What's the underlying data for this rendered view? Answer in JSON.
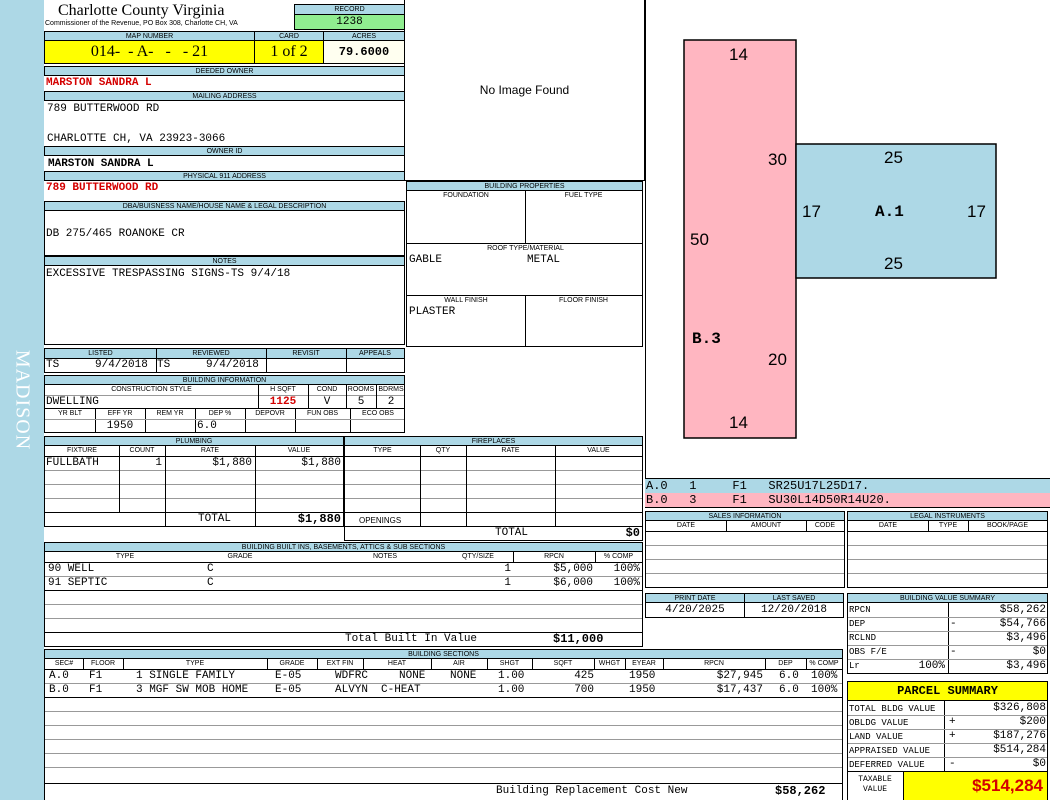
{
  "sidebar": {
    "label": "MADISON",
    "color": "#add8e6"
  },
  "header": {
    "county": "Charlotte County Virginia",
    "address": "Commissioner of the Revenue, PO Box 308, Charlotte CH, VA",
    "record_label": "RECORD",
    "record": "1238"
  },
  "parcel": {
    "map_label": "MAP NUMBER",
    "map": "014-  - A-   -   - 21",
    "card_label": "CARD",
    "card": "1 of 2",
    "acres_label": "ACRES",
    "acres": "79.6000"
  },
  "owner": {
    "deeded_label": "DEEDED OWNER",
    "deeded": "MARSTON SANDRA L",
    "mailing_label": "MAILING ADDRESS",
    "mail1": "789 BUTTERWOOD RD",
    "mail2": "CHARLOTTE CH, VA 23923-3066",
    "id_label": "OWNER ID",
    "id": "MARSTON SANDRA L",
    "phys_label": "PHYSICAL 911 ADDRESS",
    "phys": "789 BUTTERWOOD RD"
  },
  "legal": {
    "label": "DBA/BUISNESS NAME/HOUSE NAME & LEGAL DESCRIPTION",
    "text": "DB 275/465 ROANOKE CR"
  },
  "notes": {
    "label": "NOTES",
    "text": "EXCESSIVE TRESPASSING SIGNS-TS 9/4/18"
  },
  "photo": {
    "text": "No Image Found"
  },
  "building_props": {
    "title": "BUILDING PROPERTIES",
    "foundation_label": "FOUNDATION",
    "fuel_label": "FUEL TYPE",
    "roof_label": "ROOF TYPE/MATERIAL",
    "roof_type": "GABLE",
    "roof_material": "METAL",
    "wall_label": "WALL FINISH",
    "floor_label": "FLOOR FINISH",
    "wall": "PLASTER"
  },
  "review": {
    "listed_label": "LISTED",
    "reviewed_label": "REVIEWED",
    "revisit_label": "REVISIT",
    "appeals_label": "APPEALS",
    "listed_by": "TS",
    "listed_date": "9/4/2018",
    "reviewed_by": "TS",
    "reviewed_date": "9/4/2018"
  },
  "building_info": {
    "title": "BUILDING INFORMATION",
    "cs_label": "CONSTRUCTION STYLE",
    "hsqft_label": "H SQFT",
    "cond_label": "COND",
    "rooms_label": "ROOMS",
    "bdrms_label": "BDRMS",
    "style": "DWELLING",
    "hsqft": "1125",
    "cond": "V",
    "rooms": "5",
    "bdrms": "2",
    "yrblt_label": "YR BLT",
    "effyr_label": "EFF YR",
    "remyr_label": "REM YR",
    "dep_label": "DEP %",
    "depovr_label": "DEPOVR",
    "funobs_label": "FUN OBS",
    "ecoobs_label": "ECO OBS",
    "effyr": "1950",
    "dep": "6.0"
  },
  "plumbing": {
    "title": "PLUMBING",
    "headers": [
      "FIXTURE",
      "COUNT",
      "RATE",
      "VALUE"
    ],
    "rows": [
      {
        "fixture": "FULLBATH",
        "count": "1",
        "rate": "$1,880",
        "value": "$1,880"
      }
    ],
    "total_label": "TOTAL",
    "total": "$1,880"
  },
  "fireplaces": {
    "title": "FIREPLACES",
    "headers": [
      "TYPE",
      "QTY",
      "RATE",
      "VALUE"
    ],
    "openings_label": "OPENINGS",
    "total_label": "TOTAL",
    "total": "$0"
  },
  "builtins": {
    "title": "BUILDING BUILT INS, BASEMENTS, ATTICS & SUB SECTIONS",
    "headers": [
      "TYPE",
      "GRADE",
      "NOTES",
      "QTY/SIZE",
      "RPCN",
      "% COMP"
    ],
    "rows": [
      {
        "type": "90 WELL",
        "grade": "C",
        "qty": "1",
        "rpcn": "$5,000",
        "comp": "100%"
      },
      {
        "type": "91 SEPTIC",
        "grade": "C",
        "qty": "1",
        "rpcn": "$6,000",
        "comp": "100%"
      }
    ],
    "total_label": "Total Built In Value",
    "total": "$11,000"
  },
  "sections": {
    "title": "BUILDING SECTIONS",
    "headers": [
      "SEC#",
      "FLOOR",
      "TYPE",
      "GRADE",
      "EXT FIN",
      "HEAT",
      "AIR",
      "SHGT",
      "SQFT",
      "WHGT",
      "EYEAR",
      "RPCN",
      "DEP",
      "% COMP"
    ],
    "rows": [
      {
        "sec": "A.0",
        "floor": "F1",
        "type": "1 SINGLE FAMILY",
        "grade": "E-05",
        "ext": "WDFRC",
        "heat": "NONE",
        "air": "NONE",
        "shgt": "1.00",
        "sqft": "425",
        "whgt": "",
        "eyear": "1950",
        "rpcn": "$27,945",
        "dep": "6.0",
        "comp": "100%"
      },
      {
        "sec": "B.0",
        "floor": "F1",
        "type": "3 MGF SW MOB HOME",
        "grade": "E-05",
        "ext": "ALVYN",
        "heat": "C-HEAT",
        "air": "",
        "shgt": "1.00",
        "sqft": "700",
        "whgt": "",
        "eyear": "1950",
        "rpcn": "$17,437",
        "dep": "6.0",
        "comp": "100%"
      }
    ],
    "total_label": "Building Replacement Cost New",
    "total": "$58,262"
  },
  "sketch": {
    "colors": {
      "b": "#ffb6c1",
      "a": "#add8e6"
    },
    "b_label": "B.3",
    "a_label": "A.1",
    "b_top": "14",
    "b_bottom": "14",
    "b_left": "50",
    "b_right_upper": "30",
    "b_right_lower": "20",
    "a_top": "25",
    "a_bottom": "25",
    "a_left": "17",
    "a_right": "17",
    "legend": [
      {
        "text": "A.0   1     F1   SR25U17L25D17."
      },
      {
        "text": "B.0   3     F1   SU30L14D50R14U20."
      }
    ]
  },
  "sales": {
    "title": "SALES INFORMATION",
    "headers": [
      "DATE",
      "AMOUNT",
      "CODE"
    ]
  },
  "legal_instruments": {
    "title": "LEGAL INSTRUMENTS",
    "headers": [
      "DATE",
      "TYPE",
      "BOOK/PAGE"
    ]
  },
  "dates": {
    "print_label": "PRINT DATE",
    "print": "4/20/2025",
    "saved_label": "LAST SAVED",
    "saved": "12/20/2018"
  },
  "value_summary": {
    "title": "BUILDING VALUE SUMMARY",
    "rows": [
      {
        "label": "RPCN",
        "op": "",
        "value": "$58,262"
      },
      {
        "label": "DEP",
        "op": "-",
        "value": "$54,766"
      },
      {
        "label": "RCLND",
        "op": "",
        "value": "$3,496"
      },
      {
        "label": "OBS F/E",
        "op": "-",
        "value": "$0"
      },
      {
        "label": "Lr",
        "op": "100%",
        "value": "$3,496"
      }
    ]
  },
  "parcel_summary": {
    "title": "PARCEL SUMMARY",
    "rows": [
      {
        "label": "TOTAL BLDG VALUE",
        "op": "",
        "value": "$326,808"
      },
      {
        "label": "OBLDG VALUE",
        "op": "+",
        "value": "$200"
      },
      {
        "label": "LAND VALUE",
        "op": "+",
        "value": "$187,276"
      },
      {
        "label": "APPRAISED VALUE",
        "op": "",
        "value": "$514,284"
      },
      {
        "label": "DEFERRED VALUE",
        "op": "-",
        "value": "$0"
      }
    ],
    "taxable_label": "TAXABLE VALUE",
    "taxable": "$514,284"
  }
}
